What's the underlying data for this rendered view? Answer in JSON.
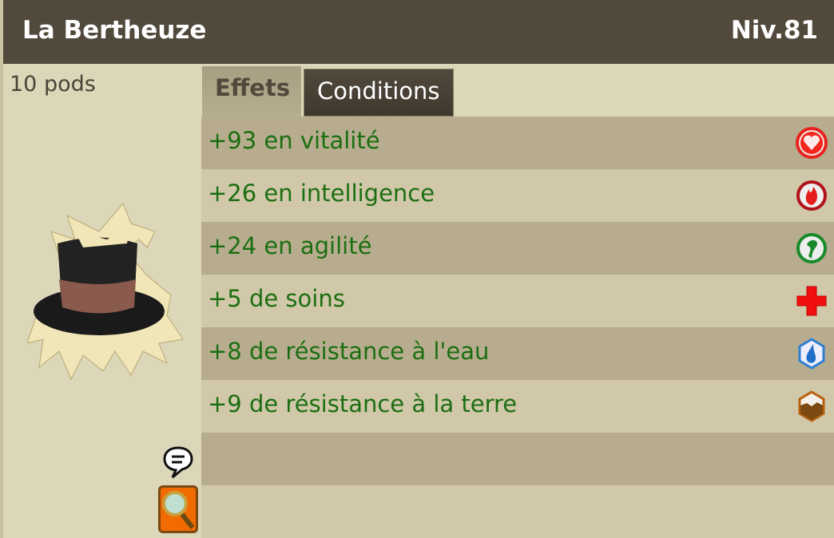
{
  "header": {
    "title": "La Bertheuze",
    "level": "Niv.81"
  },
  "item": {
    "weight": "10 pods",
    "image": "top-hat-with-straw-hair"
  },
  "tabs": [
    {
      "label": "Effets",
      "active": true
    },
    {
      "label": "Conditions",
      "active": false
    }
  ],
  "effects": [
    {
      "text": "+93 en vitalité",
      "icon": "heart-icon"
    },
    {
      "text": "+26 en intelligence",
      "icon": "fire-icon"
    },
    {
      "text": "+24 en agilité",
      "icon": "air-icon"
    },
    {
      "text": "+5 de soins",
      "icon": "heal-cross-icon"
    },
    {
      "text": "+8 de résistance à l'eau",
      "icon": "water-drop-icon"
    },
    {
      "text": "+9 de résistance à la terre",
      "icon": "earth-icon"
    }
  ]
}
